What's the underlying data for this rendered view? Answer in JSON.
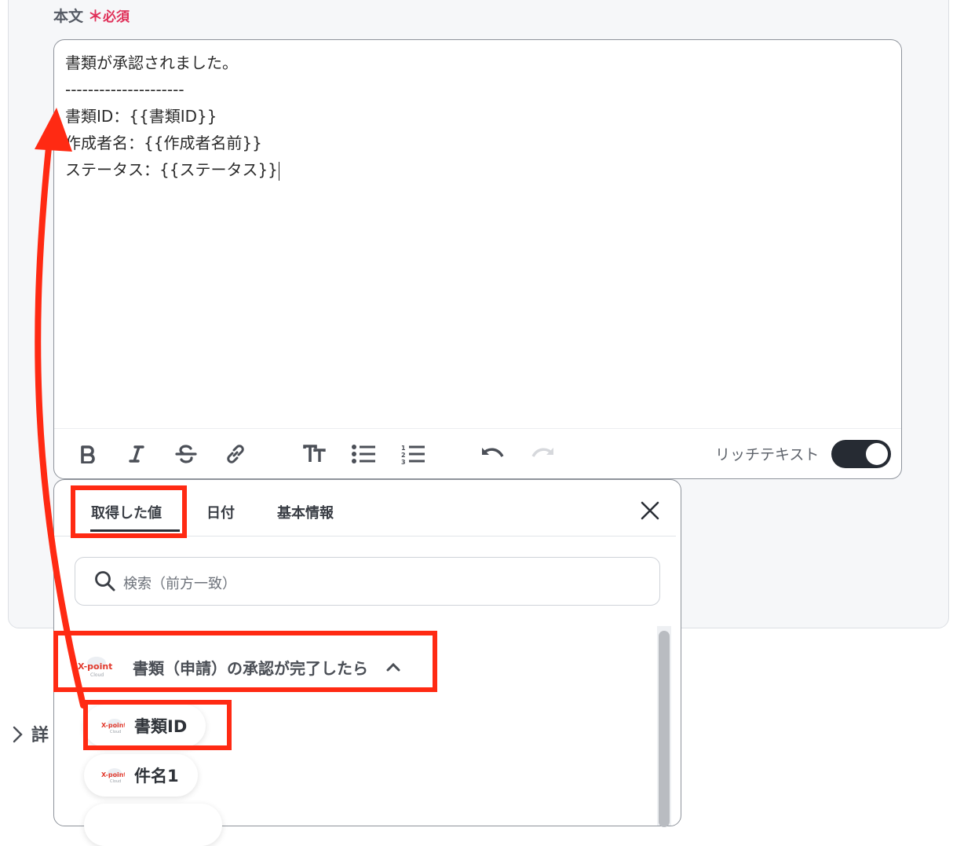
{
  "field": {
    "label": "本文",
    "required_mark": "＊",
    "required_text": "必須"
  },
  "editor": {
    "lines": [
      "書類が承認されました。",
      "---------------------",
      "書類ID：{{書類ID}}",
      "作成者名：{{作成者名前}}",
      "ステータス：{{ステータス}}"
    ],
    "toolbar": {
      "buttons": [
        "bold-icon",
        "italic-icon",
        "strikethrough-icon",
        "link-icon",
        "text-size-icon",
        "bullet-list-icon",
        "numbered-list-icon",
        "undo-icon",
        "redo-icon"
      ],
      "rich_text_label": "リッチテキスト",
      "rich_text_enabled": true
    }
  },
  "panel": {
    "tabs": [
      {
        "label": "取得した値",
        "active": true
      },
      {
        "label": "日付",
        "active": false
      },
      {
        "label": "基本情報",
        "active": false
      }
    ],
    "search_placeholder": "検索（前方一致）",
    "group": {
      "label": "書類（申請）の承認が完了したら",
      "expanded": true,
      "logo_text": "X-point",
      "logo_sub": "Cloud"
    },
    "items": [
      "書類ID",
      "件名1"
    ]
  },
  "detail": {
    "label": "詳"
  },
  "colors": {
    "annotation_red": "#ff2a13",
    "required_pink": "#e0315a",
    "toggle_dark": "#262b33"
  }
}
